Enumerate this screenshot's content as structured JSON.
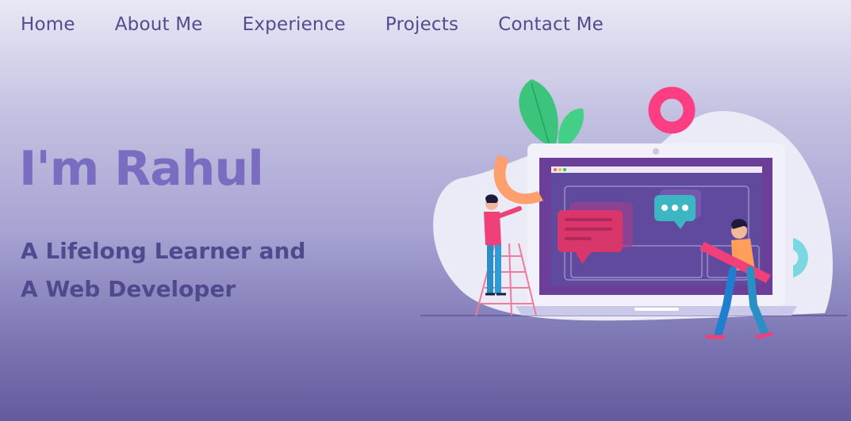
{
  "nav": {
    "items": [
      {
        "label": "Home"
      },
      {
        "label": "About Me"
      },
      {
        "label": "Experience"
      },
      {
        "label": "Projects"
      },
      {
        "label": "Contact Me"
      }
    ]
  },
  "hero": {
    "name": "I'm Rahul",
    "tagline_line1": "A Lifelong Learner and",
    "tagline_line2": "A Web Developer"
  },
  "colors": {
    "nav_text": "#524c8e",
    "name_text": "#7a6cc0",
    "tagline_text": "#4f4a8e",
    "accent_pink": "#ff3d82",
    "screen_purple": "#6b3e98"
  },
  "illustration": {
    "icon": "web-developer-illustration"
  }
}
